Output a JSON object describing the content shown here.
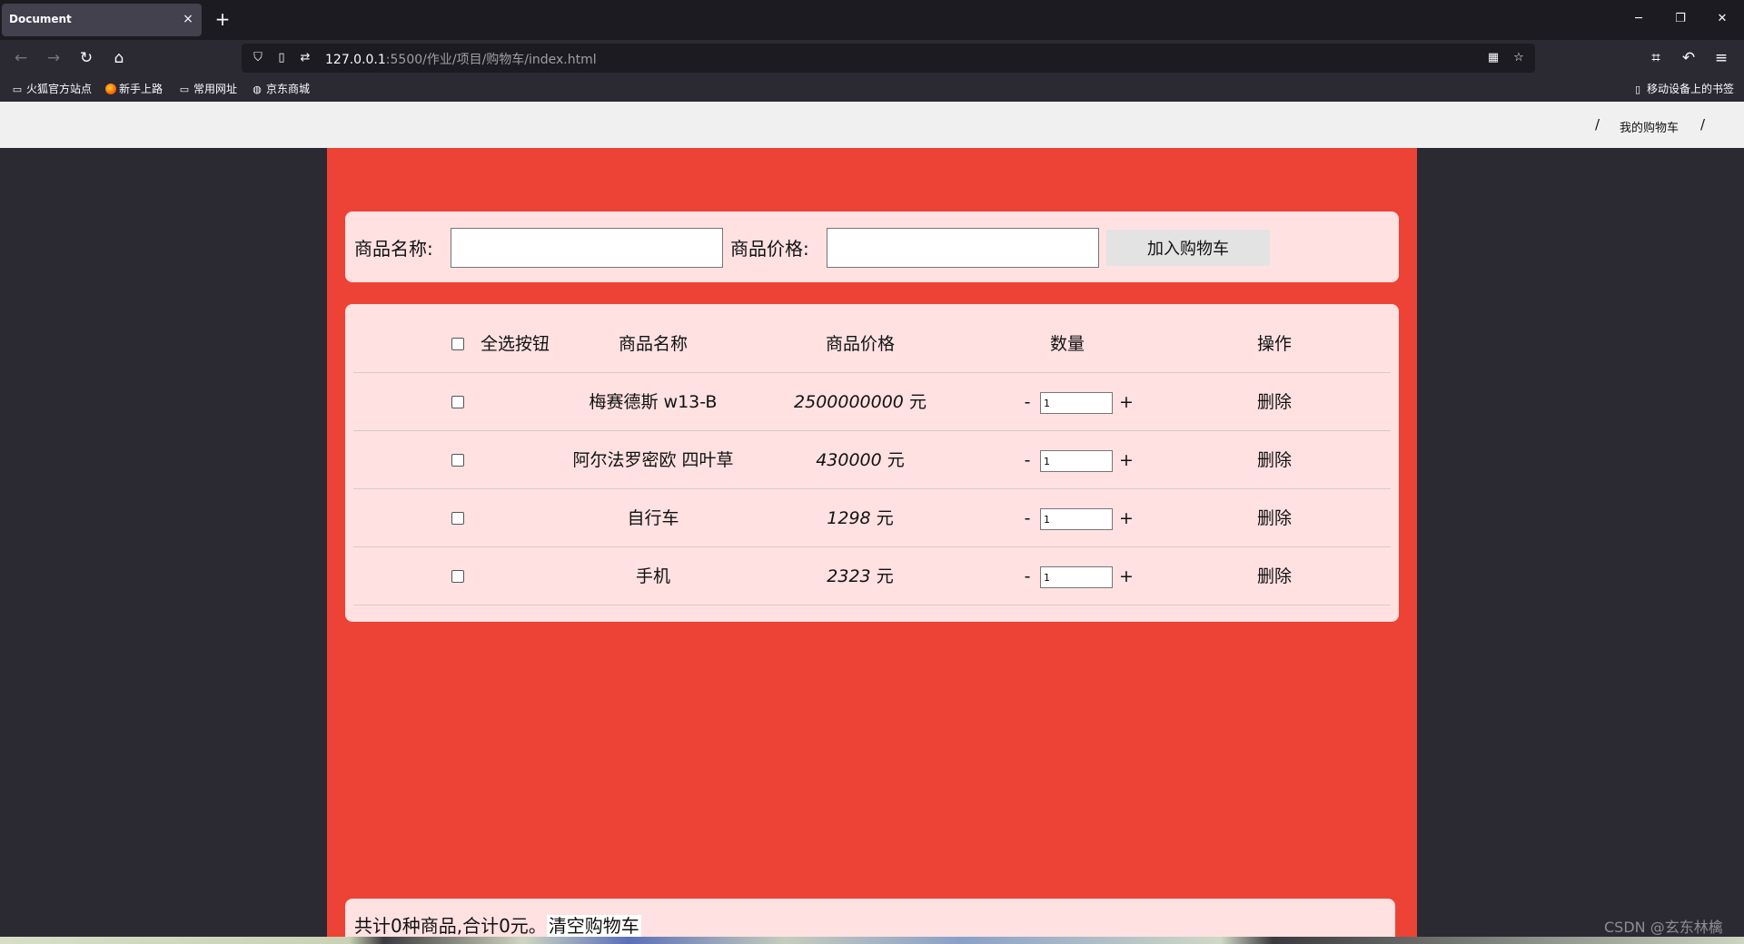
{
  "browser": {
    "tab_title": "Document",
    "tab_close": "×",
    "new_tab": "+",
    "minimize": "─",
    "restore": "❐",
    "close": "✕",
    "back": "←",
    "forward": "→",
    "reload": "↻",
    "home": "⌂",
    "url_host": "127.0.0.1",
    "url_rest": ":5500/作业/项目/购物车/index.html",
    "bookmarks": [
      "火狐官方站点",
      "新手上路",
      "常用网址",
      "京东商城"
    ],
    "mobile_bookmarks": "移动设备上的书签"
  },
  "page": {
    "breadcrumb_sep": "/",
    "breadcrumb_link": "我的购物车",
    "form": {
      "name_label": "商品名称:",
      "price_label": "商品价格:",
      "name_value": "",
      "price_value": "",
      "add_button": "加入购物车"
    },
    "table": {
      "select_all": "全选按钮",
      "headers": [
        "商品名称",
        "商品价格",
        "数量",
        "操作"
      ],
      "rows": [
        {
          "name": "梅赛德斯 w13-B",
          "price": "2500000000",
          "unit": "元",
          "qty": "1",
          "checked": false
        },
        {
          "name": "阿尔法罗密欧 四叶草",
          "price": "430000",
          "unit": "元",
          "qty": "1",
          "checked": false
        },
        {
          "name": "自行车",
          "price": "1298",
          "unit": "元",
          "qty": "1",
          "checked": false
        },
        {
          "name": "手机",
          "price": "2323",
          "unit": "元",
          "qty": "1",
          "checked": false
        }
      ],
      "minus": "-",
      "plus": "+",
      "delete": "删除"
    },
    "footer": {
      "summary": "共计0种商品,合计0元。",
      "clear_button": "清空购物车"
    },
    "watermark": "CSDN @玄东林檎"
  },
  "colors": {
    "container": "#ec4336",
    "panel": "#ffe1e1",
    "chrome_dark": "#1c1b22",
    "chrome": "#2b2a33"
  }
}
